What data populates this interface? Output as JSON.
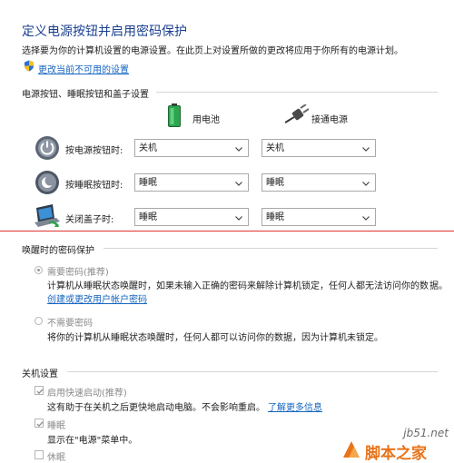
{
  "header": {
    "title": "定义电源按钮并启用密码保护",
    "description": "选择要为你的计算机设置的电源设置。在此页上对设置所做的更改将应用于你所有的电源计划。",
    "change_unavailable_link": "更改当前不可用的设置"
  },
  "power_buttons": {
    "section_title": "电源按钮、睡眠按钮和盖子设置",
    "on_battery_label": "用电池",
    "plugged_in_label": "接通电源",
    "rows": [
      {
        "label": "按电源按钮时:",
        "battery": "关机",
        "plugged": "关机",
        "icon": "power-button-icon"
      },
      {
        "label": "按睡眠按钮时:",
        "battery": "睡眠",
        "plugged": "睡眠",
        "icon": "sleep-button-icon"
      },
      {
        "label": "关闭盖子时:",
        "battery": "睡眠",
        "plugged": "睡眠",
        "icon": "laptop-lid-icon"
      }
    ]
  },
  "wake_password": {
    "section_title": "唤醒时的密码保护",
    "require": {
      "label": "需要密码(推荐)",
      "description": "计算机从睡眠状态唤醒时，如果未输入正确的密码来解除计算机锁定，任何人都无法访问你的数",
      "description_cont": "据。",
      "link": "创建或更改用户帐户密码",
      "selected": true
    },
    "no_require": {
      "label": "不需要密码",
      "description": "将你的计算机从睡眠状态唤醒时，任何人都可以访问你的数据，因为计算机未锁定。",
      "selected": false
    }
  },
  "shutdown": {
    "section_title": "关机设置",
    "fast_startup": {
      "label": "启用快速启动(推荐)",
      "description": "这有助于在关机之后更快地启动电脑。不会影响重启。",
      "link": "了解更多信息",
      "checked": true
    },
    "sleep": {
      "label": "睡眠",
      "description": "显示在\"电源\"菜单中。",
      "checked": true
    },
    "hibernate": {
      "label": "休眠",
      "checked": false
    }
  },
  "watermark": {
    "site": "jb51.net",
    "name": "脚本之家"
  },
  "colors": {
    "title_blue": "#1a3f8f",
    "link_blue": "#1565c0",
    "separator_red": "#e03030",
    "watermark_orange": "#e8731a"
  }
}
